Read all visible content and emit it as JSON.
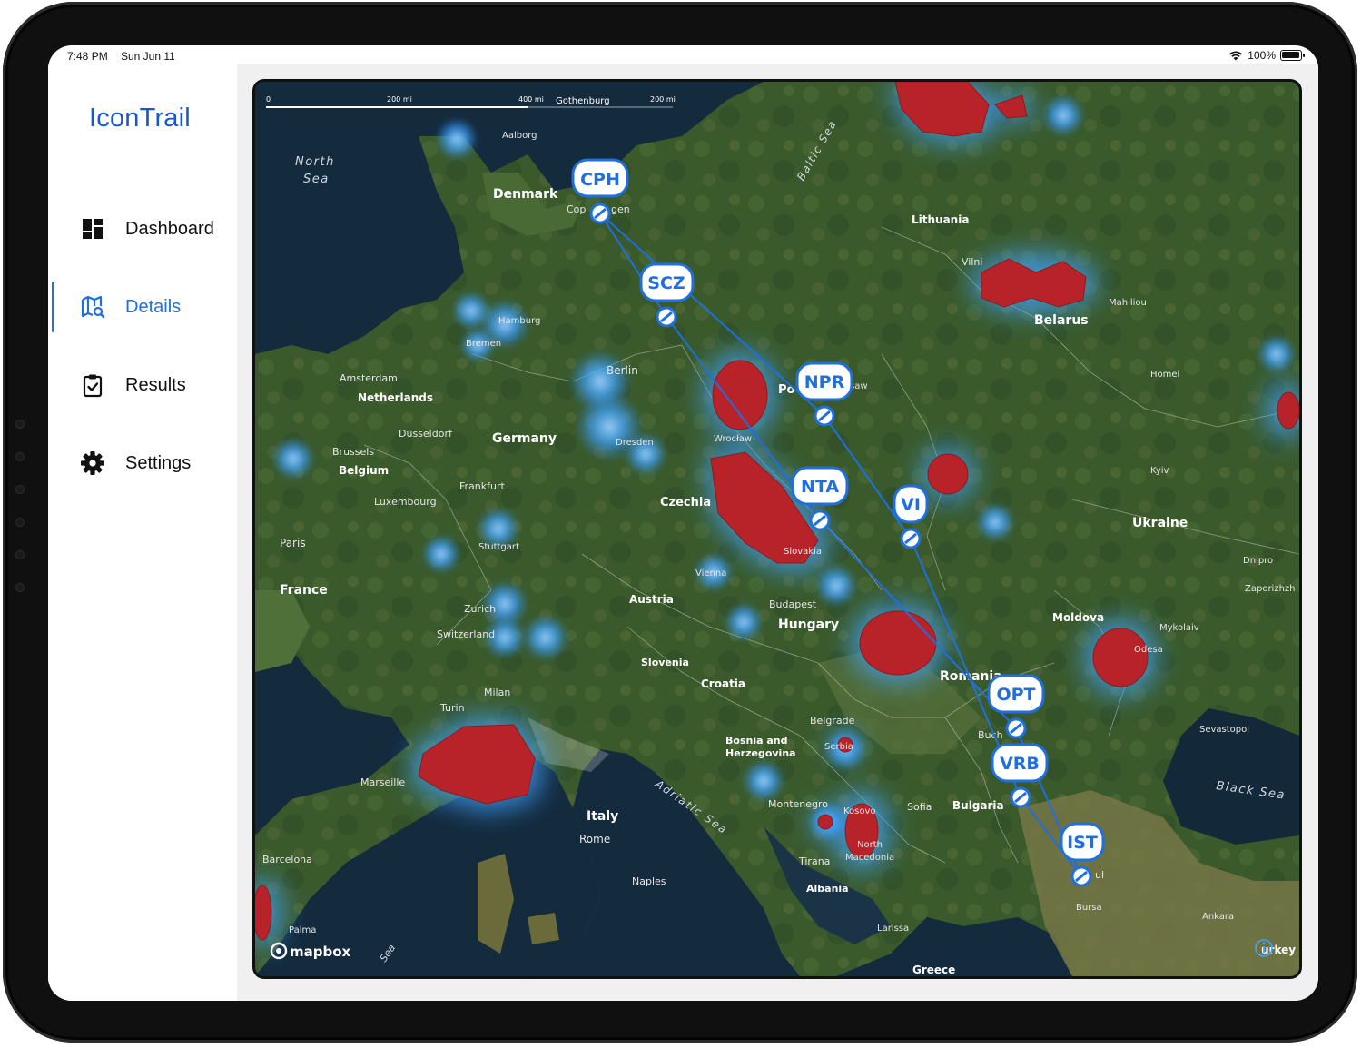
{
  "status_bar": {
    "time": "7:48 PM",
    "date": "Sun Jun 11",
    "battery": "100%"
  },
  "app": {
    "title": "IconTrail"
  },
  "nav": {
    "items": [
      {
        "label": "Dashboard",
        "icon": "dashboard-grid-icon"
      },
      {
        "label": "Details",
        "icon": "map-search-icon",
        "active": true
      },
      {
        "label": "Results",
        "icon": "clipboard-check-icon"
      },
      {
        "label": "Settings",
        "icon": "gear-icon"
      }
    ]
  },
  "map": {
    "provider": "mapbox",
    "scale": {
      "t0": "0",
      "t1": "200 mi",
      "t2": "400 mi",
      "t3": "Gothenburg",
      "t4": "200 mi"
    },
    "labels": {
      "north_sea": "North",
      "north_sea2": "Sea",
      "baltic_sea": "Baltic Sea",
      "denmark": "Denmark",
      "copenhagen": "Cop",
      "copenhagen2": "gen",
      "aalborg": "Aalborg",
      "lithuania": "Lithuania",
      "vilnius": "Vilni",
      "belarus": "Belarus",
      "mahiliou": "Mahiliou",
      "hamburg": "Hamburg",
      "bremen": "Bremen",
      "berlin": "Berlin",
      "amsterdam": "Amsterdam",
      "netherlands": "Netherlands",
      "dusseldorf": "Düsseldorf",
      "germany": "Germany",
      "brussels": "Brussels",
      "belgium": "Belgium",
      "frankfurt": "Frankfurt",
      "luxembourg": "Luxembourg",
      "dresden": "Dresden",
      "wroclaw": "Wrocław",
      "warsaw": "saw",
      "poland": "Po",
      "homel": "Homel",
      "kyiv": "Kyiv",
      "ukraine": "Ukraine",
      "czechia": "Czechia",
      "paris": "Paris",
      "stuttgart": "Stuttgart",
      "france": "France",
      "vienna": "Vienna",
      "slovakia": "Slovakia",
      "zurich": "Zurich",
      "austria": "Austria",
      "budapest": "Budapest",
      "hungary": "Hungary",
      "dnipro": "Dnipro",
      "zaporizhzh": "Zaporizhzh",
      "switzerland": "Switzerland",
      "moldova": "Moldova",
      "mykolaiv": "Mykolaiv",
      "odesa": "Odesa",
      "slovenia": "Slovenia",
      "milan": "Milan",
      "croatia": "Croatia",
      "romania": "Romania",
      "turin": "Turin",
      "belgrade": "Belgrade",
      "sevastopol": "Sevastopol",
      "bosnia": "Bosnia and",
      "herzegovina": "Herzegovina",
      "serbia": "Serbia",
      "bucharest": "Buch",
      "marseille": "Marseille",
      "adriatic": "Adriatic Sea",
      "black_sea": "Black Sea",
      "montenegro": "Montenegro",
      "kosovo": "Kosovo",
      "sofia": "Sofia",
      "bulgaria": "Bulgaria",
      "italy": "Italy",
      "rome": "Rome",
      "north_macedonia": "North",
      "north_macedonia2": "Macedonia",
      "barcelona": "Barcelona",
      "tirana": "Tirana",
      "istanbul": "ul",
      "naples": "Naples",
      "albania": "Albania",
      "bursa": "Bursa",
      "larissa": "Larissa",
      "ankara": "Ankara",
      "palma": "Palma",
      "sea_sw": "Sea",
      "greece": "Greece",
      "turkey": "urkey"
    },
    "markers": [
      {
        "code": "CPH"
      },
      {
        "code": "SCZ"
      },
      {
        "code": "NPR"
      },
      {
        "code": "NTA"
      },
      {
        "code": "VI"
      },
      {
        "code": "OPT"
      },
      {
        "code": "VRB"
      },
      {
        "code": "IST"
      }
    ],
    "colors": {
      "route": "#1f6fe0",
      "heat_hot": "#b8232a",
      "heat_cool": "#3fa3ff",
      "marker_fill": "#ffffff",
      "marker_text": "#1f6fe0"
    }
  }
}
